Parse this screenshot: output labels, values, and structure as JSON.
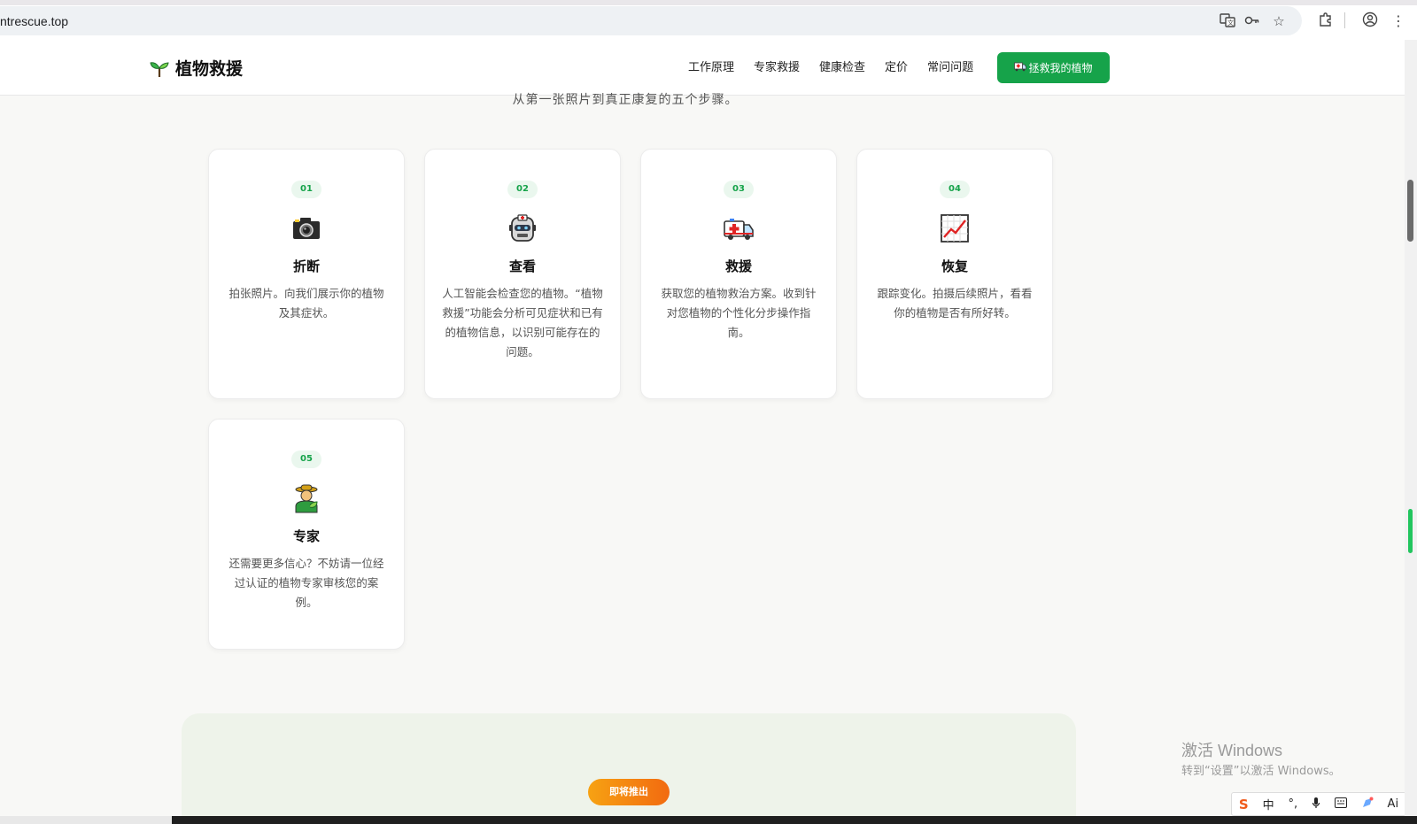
{
  "browser": {
    "url": "tantrescue.top",
    "url_visible": "ntrescue.top",
    "icons": [
      "translate-icon",
      "password-key-icon",
      "bookmark-star-icon",
      "extensions-puzzle-icon",
      "profile-icon",
      "menu-dots-icon"
    ]
  },
  "header": {
    "brand_name": "植物救援",
    "nav": [
      "工作原理",
      "专家救援",
      "健康检查",
      "定价",
      "常问问题"
    ],
    "cta_label": "拯救我的植物"
  },
  "section": {
    "subtitle": "从第一张照片到真正康复的五个步骤。"
  },
  "steps": [
    {
      "num": "01",
      "icon": "camera-icon",
      "title": "折断",
      "desc": "拍张照片。向我们展示你的植物及其症状。"
    },
    {
      "num": "02",
      "icon": "robot-doctor-icon",
      "title": "查看",
      "desc": "人工智能会检查您的植物。“植物救援”功能会分析可见症状和已有的植物信息，以识别可能存在的问题。"
    },
    {
      "num": "03",
      "icon": "ambulance-icon",
      "title": "救援",
      "desc": "获取您的植物救治方案。收到针对您植物的个性化分步操作指南。"
    },
    {
      "num": "04",
      "icon": "chart-increasing-icon",
      "title": "恢复",
      "desc": "跟踪变化。拍摄后续照片，看看你的植物是否有所好转。"
    },
    {
      "num": "05",
      "icon": "farmer-icon",
      "title": "专家",
      "desc": "还需要更多信心？不妨请一位经过认证的植物专家审核您的案例。"
    }
  ],
  "coming_soon_label": "即将推出",
  "watermark": {
    "title": "激活 Windows",
    "sub": "转到“设置”以激活 Windows。"
  },
  "ime": {
    "lang": "中",
    "ai": "Ai"
  }
}
